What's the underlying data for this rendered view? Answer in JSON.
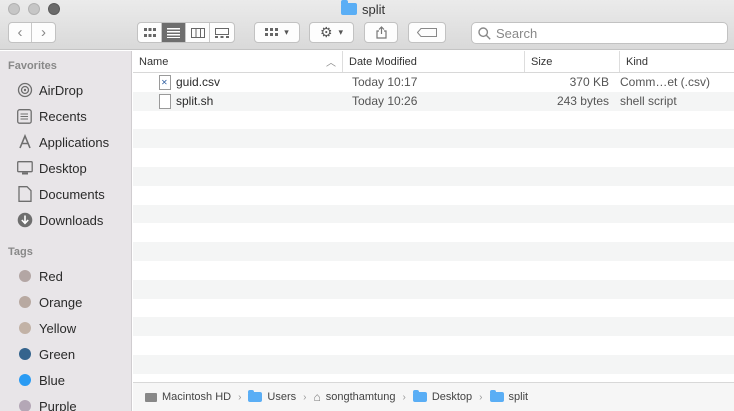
{
  "window": {
    "title": "split"
  },
  "search": {
    "placeholder": "Search"
  },
  "sidebar": {
    "favorites_header": "Favorites",
    "favorites": [
      {
        "label": "AirDrop",
        "icon": "airdrop-icon"
      },
      {
        "label": "Recents",
        "icon": "recents-icon"
      },
      {
        "label": "Applications",
        "icon": "applications-icon"
      },
      {
        "label": "Desktop",
        "icon": "desktop-icon"
      },
      {
        "label": "Documents",
        "icon": "documents-icon"
      },
      {
        "label": "Downloads",
        "icon": "downloads-icon"
      }
    ],
    "tags_header": "Tags",
    "tags": [
      {
        "label": "Red",
        "color": "#b3a6a4"
      },
      {
        "label": "Orange",
        "color": "#b8a9a1"
      },
      {
        "label": "Yellow",
        "color": "#c2b2a6"
      },
      {
        "label": "Green",
        "color": "#35648d"
      },
      {
        "label": "Blue",
        "color": "#2a9bf3"
      },
      {
        "label": "Purple",
        "color": "#b4a7b6"
      }
    ]
  },
  "columns": {
    "name": "Name",
    "date": "Date Modified",
    "size": "Size",
    "kind": "Kind"
  },
  "files": [
    {
      "name": "guid.csv",
      "date": "Today 10:17",
      "size": "370 KB",
      "kind": "Comm…et (.csv)"
    },
    {
      "name": "split.sh",
      "date": "Today 10:26",
      "size": "243 bytes",
      "kind": "shell script"
    }
  ],
  "path": {
    "items": [
      "Macintosh HD",
      "Users",
      "songthamtung",
      "Desktop",
      "split"
    ]
  },
  "colors": {
    "accent": "#5aaef5",
    "active_view": "#6e6e6e"
  }
}
